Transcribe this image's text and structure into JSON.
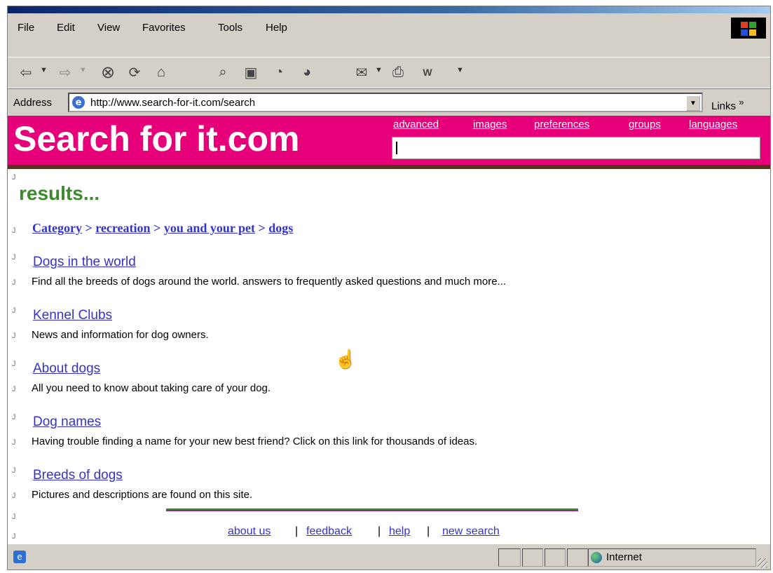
{
  "menu": [
    "File",
    "Edit",
    "View",
    "Favorites",
    "Tools",
    "Help"
  ],
  "address": {
    "label": "Address",
    "url": "http://www.search-for-it.com/search",
    "links_label": "Links",
    "links_chevron": "»"
  },
  "site": {
    "logo": "Search for it.com",
    "top_links": [
      "advanced",
      "images",
      "preferences",
      "groups",
      "languages"
    ],
    "search_value": ""
  },
  "heading": "results...",
  "breadcrumb": {
    "items": [
      "Category",
      "recreation",
      "you and your pet",
      "dogs"
    ],
    "separator": ">"
  },
  "results": [
    {
      "title": "Dogs in the world",
      "desc": "Find all the breeds of dogs around the world. answers to frequently asked questions and much more..."
    },
    {
      "title": "Kennel Clubs",
      "desc": "News and information for dog owners."
    },
    {
      "title": "About dogs",
      "desc": "All you need to know about taking care of your dog."
    },
    {
      "title": "Dog names",
      "desc": "Having trouble finding a name for your new best friend? Click on this link for thousands of ideas."
    },
    {
      "title": "Breeds of dogs",
      "desc": "Pictures and descriptions are found on this site."
    }
  ],
  "footer": {
    "links": [
      "about us",
      "feedback",
      "help",
      "new search"
    ],
    "separator": "|"
  },
  "status": {
    "zone": "Internet"
  },
  "colors": {
    "banner": "#e6007a",
    "heading": "#3d8a2e",
    "link": "#3333cc"
  },
  "icons": [
    "back-icon",
    "forward-icon",
    "stop-icon",
    "refresh-icon",
    "home-icon",
    "search-icon",
    "favorites-icon",
    "history-icon",
    "media-icon",
    "mail-icon",
    "print-icon",
    "word-icon",
    "hand-cursor-icon",
    "globe-icon"
  ]
}
